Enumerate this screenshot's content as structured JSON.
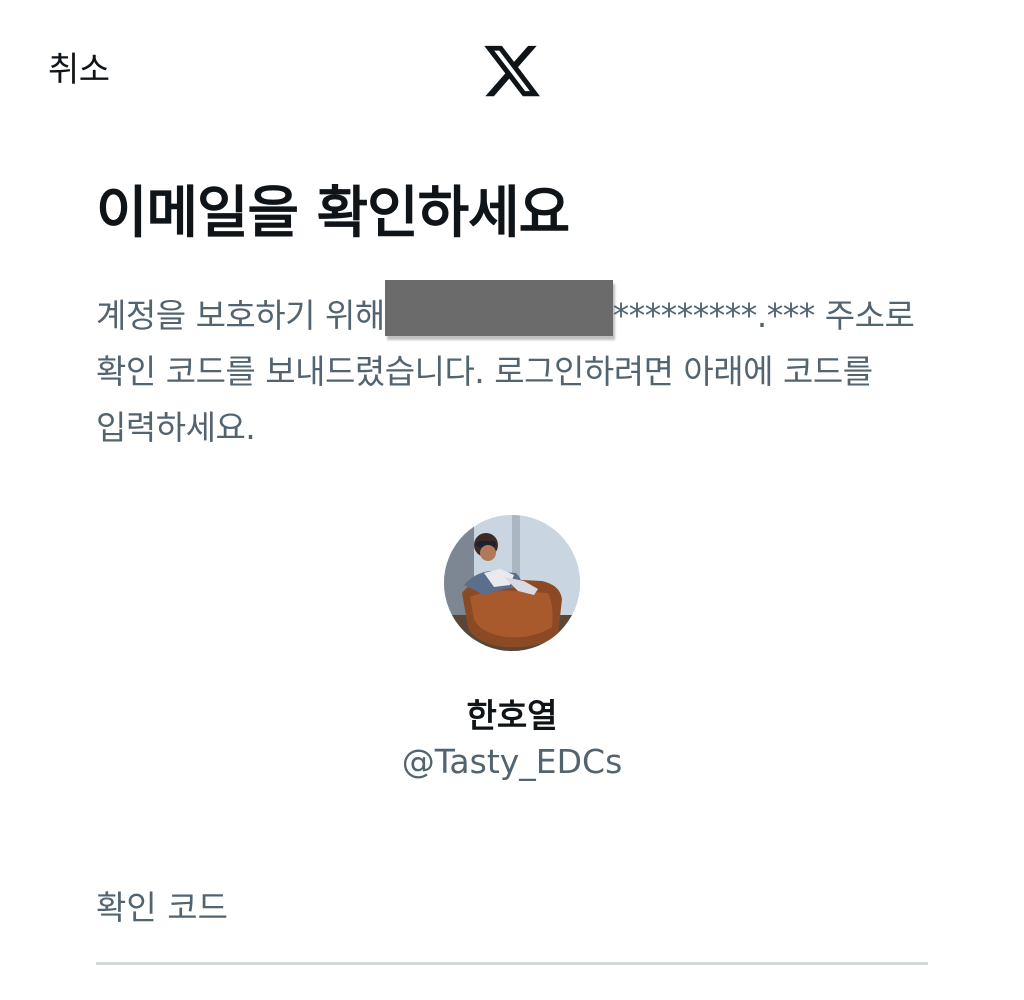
{
  "header": {
    "cancel_label": "취소",
    "logo_icon": "x-logo-icon"
  },
  "main": {
    "title": "이메일을 확인하세요",
    "description_before": "계정을 보호하기 위해",
    "description_masked_email": "*********.***",
    "description_after": " 주소로 확인 코드를 보내드렸습니다. 로그인하려면 아래에 코드를 입력하세요."
  },
  "profile": {
    "name": "한호열",
    "handle": "@Tasty_EDCs"
  },
  "code_field": {
    "label": "확인 코드",
    "value": ""
  },
  "colors": {
    "primary_text": "#0f1419",
    "secondary_text": "#536471",
    "divider": "#cfd9de"
  }
}
